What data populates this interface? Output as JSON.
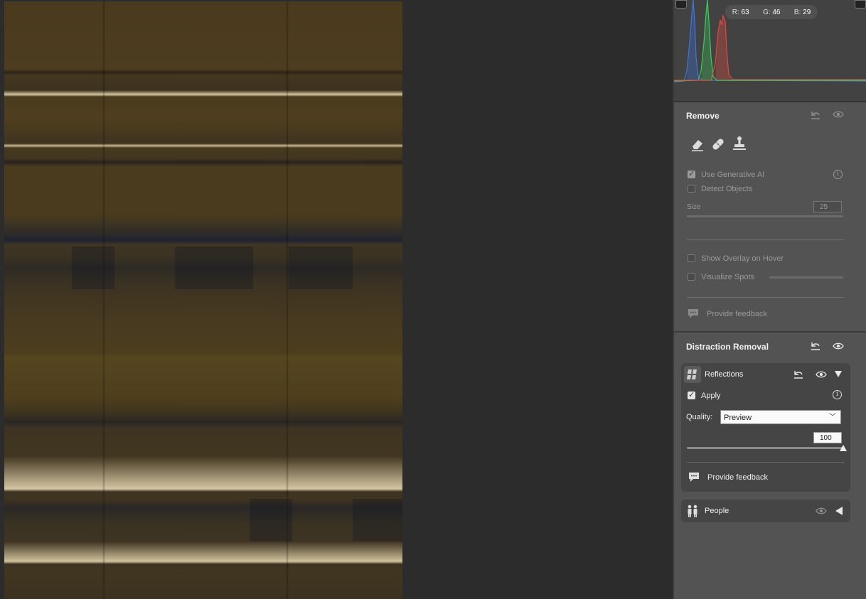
{
  "histogram": {
    "readout": {
      "r_label": "R:",
      "r_value": "63",
      "g_label": "G:",
      "g_value": "46",
      "b_label": "B:",
      "b_value": "29"
    }
  },
  "remove": {
    "title": "Remove",
    "tools": [
      "eraser-icon",
      "bandage-icon",
      "stamp-icon"
    ],
    "use_generative_ai": {
      "label": "Use Generative AI",
      "checked": true
    },
    "detect_objects": {
      "label": "Detect Objects",
      "checked": false
    },
    "size_label": "Size",
    "size_value": "25",
    "show_overlay": {
      "label": "Show Overlay on Hover",
      "checked": false
    },
    "visualize_spots": {
      "label": "Visualize Spots",
      "checked": false
    },
    "feedback": "Provide feedback"
  },
  "distraction_removal": {
    "title": "Distraction Removal",
    "reflections": {
      "title": "Reflections",
      "apply_label": "Apply",
      "apply_checked": true,
      "quality_label": "Quality:",
      "quality_value": "Preview",
      "amount_value": "100",
      "amount_level": 1.0,
      "feedback": "Provide feedback"
    },
    "people": {
      "title": "People"
    }
  },
  "colors": {
    "panel_bg": "#535353",
    "card_bg": "#454545",
    "hist_red": "#e04a3c",
    "hist_green": "#3ccf5a",
    "hist_blue": "#3c78e0"
  }
}
